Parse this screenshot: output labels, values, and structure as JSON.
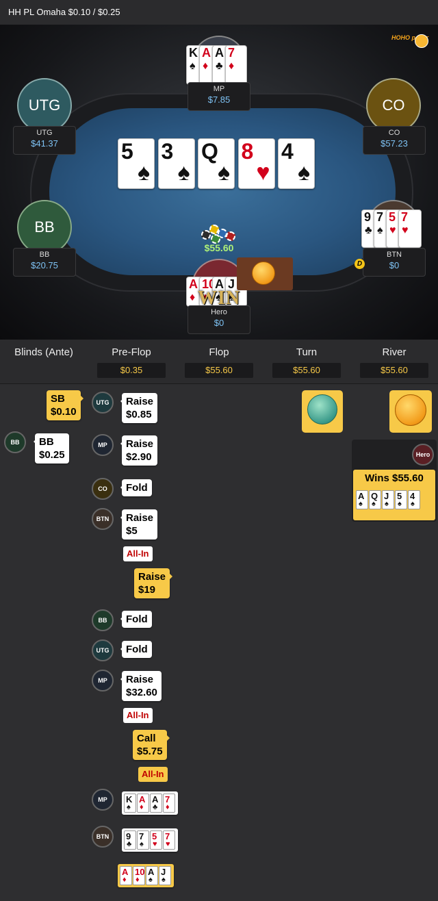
{
  "header": {
    "title": "HH PL Omaha $0.10 / $0.25"
  },
  "seats": {
    "utg": {
      "avatar": "UTG",
      "name": "UTG",
      "stack": "$41.37"
    },
    "mp": {
      "name": "MP",
      "stack": "$7.85"
    },
    "co": {
      "avatar": "CO",
      "name": "CO",
      "stack": "$57.23"
    },
    "bb": {
      "avatar": "BB",
      "name": "BB",
      "stack": "$20.75"
    },
    "btn": {
      "name": "BTN",
      "stack": "$0"
    },
    "hero": {
      "name": "Hero",
      "stack": "$0"
    }
  },
  "mp_cards": [
    {
      "r": "K",
      "s": "♠",
      "c": "blk"
    },
    {
      "r": "A",
      "s": "♦",
      "c": "red"
    },
    {
      "r": "A",
      "s": "♣",
      "c": "blk"
    },
    {
      "r": "7",
      "s": "♦",
      "c": "red"
    }
  ],
  "btn_cards": [
    {
      "r": "9",
      "s": "♣",
      "c": "blk"
    },
    {
      "r": "7",
      "s": "♠",
      "c": "blk"
    },
    {
      "r": "5",
      "s": "♥",
      "c": "red"
    },
    {
      "r": "7",
      "s": "♥",
      "c": "red"
    }
  ],
  "hero_cards": [
    {
      "r": "A",
      "s": "♦",
      "c": "red"
    },
    {
      "r": "10",
      "s": "♦",
      "c": "red"
    },
    {
      "r": "A",
      "s": "♠",
      "c": "blk"
    },
    {
      "r": "J",
      "s": "♠",
      "c": "blk"
    }
  ],
  "board": [
    {
      "r": "5",
      "s": "♠",
      "c": "blk"
    },
    {
      "r": "3",
      "s": "♠",
      "c": "blk"
    },
    {
      "r": "Q",
      "s": "♠",
      "c": "blk"
    },
    {
      "r": "8",
      "s": "♥",
      "c": "red"
    },
    {
      "r": "4",
      "s": "♠",
      "c": "blk"
    }
  ],
  "pot": "$55.60",
  "dealer": "D",
  "win_text": "WIN",
  "logo_text": "HOHO poker",
  "columns": [
    {
      "title": "Blinds (Ante)",
      "pot": ""
    },
    {
      "title": "Pre-Flop",
      "pot": "$0.35"
    },
    {
      "title": "Flop",
      "pot": "$55.60"
    },
    {
      "title": "Turn",
      "pot": "$55.60"
    },
    {
      "title": "River",
      "pot": "$55.60"
    }
  ],
  "blinds": {
    "sb": {
      "line1": "SB",
      "line2": "$0.10"
    },
    "bb": {
      "pos": "BB",
      "line1": "BB",
      "line2": "$0.25"
    }
  },
  "preflop": [
    {
      "pos": "UTG",
      "line1": "Raise",
      "line2": "$0.85"
    },
    {
      "pos": "MP",
      "line1": "Raise",
      "line2": "$2.90"
    },
    {
      "pos": "CO",
      "line1": "Fold",
      "line2": ""
    },
    {
      "pos": "BTN",
      "line1": "Raise",
      "line2": "$5",
      "allin": "All-In"
    },
    {
      "pos": "",
      "line1": "Raise",
      "line2": "$19"
    },
    {
      "pos": "BB",
      "line1": "Fold",
      "line2": ""
    },
    {
      "pos": "UTG",
      "line1": "Fold",
      "line2": ""
    },
    {
      "pos": "MP",
      "line1": "Raise",
      "line2": "$32.60",
      "allin": "All-In"
    },
    {
      "pos": "",
      "line1": "Call",
      "line2": "$5.75",
      "allin": "All-In"
    }
  ],
  "showdown": {
    "mp": "MP",
    "btn": "BTN"
  },
  "river": {
    "pos": "Hero",
    "wins": "Wins $55.60",
    "cards": [
      {
        "r": "A",
        "s": "♠",
        "c": "blk"
      },
      {
        "r": "Q",
        "s": "♠",
        "c": "blk"
      },
      {
        "r": "J",
        "s": "♠",
        "c": "blk"
      },
      {
        "r": "5",
        "s": "♠",
        "c": "blk"
      },
      {
        "r": "4",
        "s": "♠",
        "c": "blk"
      }
    ]
  }
}
